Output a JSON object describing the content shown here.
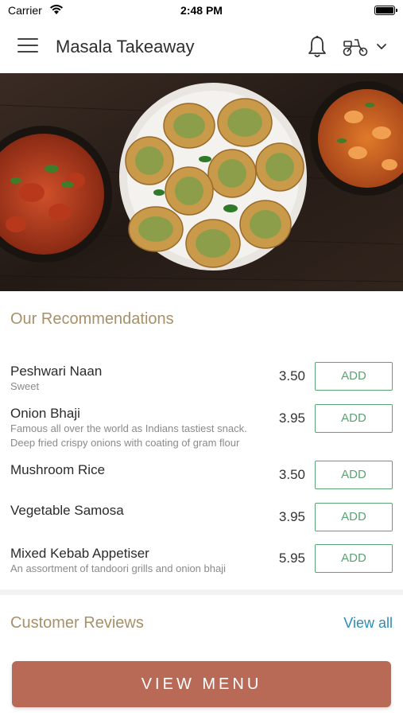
{
  "status_bar": {
    "carrier": "Carrier",
    "time": "2:48 PM",
    "battery_level": 1.0
  },
  "header": {
    "title": "Masala Takeaway",
    "icons": [
      "menu-icon",
      "bell-icon",
      "scooter-icon",
      "chevron-down-icon"
    ]
  },
  "hero": {
    "description": "food photo: curry bowl, garlic bread plate, prawn curry on dark wood"
  },
  "recommendations": {
    "title": "Our Recommendations",
    "add_label": "ADD",
    "items": [
      {
        "name": "Peshwari Naan",
        "description": "Sweet",
        "price": "3.50"
      },
      {
        "name": "Onion Bhaji",
        "description": "Famous all over the world as Indians tastiest snack. Deep fried crispy onions with coating of gram flour",
        "price": "3.95"
      },
      {
        "name": "Mushroom Rice",
        "description": "",
        "price": "3.50"
      },
      {
        "name": "Vegetable Samosa",
        "description": "",
        "price": "3.95"
      },
      {
        "name": "Mixed Kebab Appetiser",
        "description": "An assortment of tandoori grills and onion bhaji",
        "price": "5.95"
      }
    ]
  },
  "reviews": {
    "title": "Customer Reviews",
    "view_all_label": "View all"
  },
  "footer": {
    "view_menu_label": "VIEW MENU"
  },
  "colors": {
    "accent_green": "#5aa372",
    "section_title": "#a7906a",
    "link_blue": "#2a8fb8",
    "cta": "#b96a57"
  }
}
